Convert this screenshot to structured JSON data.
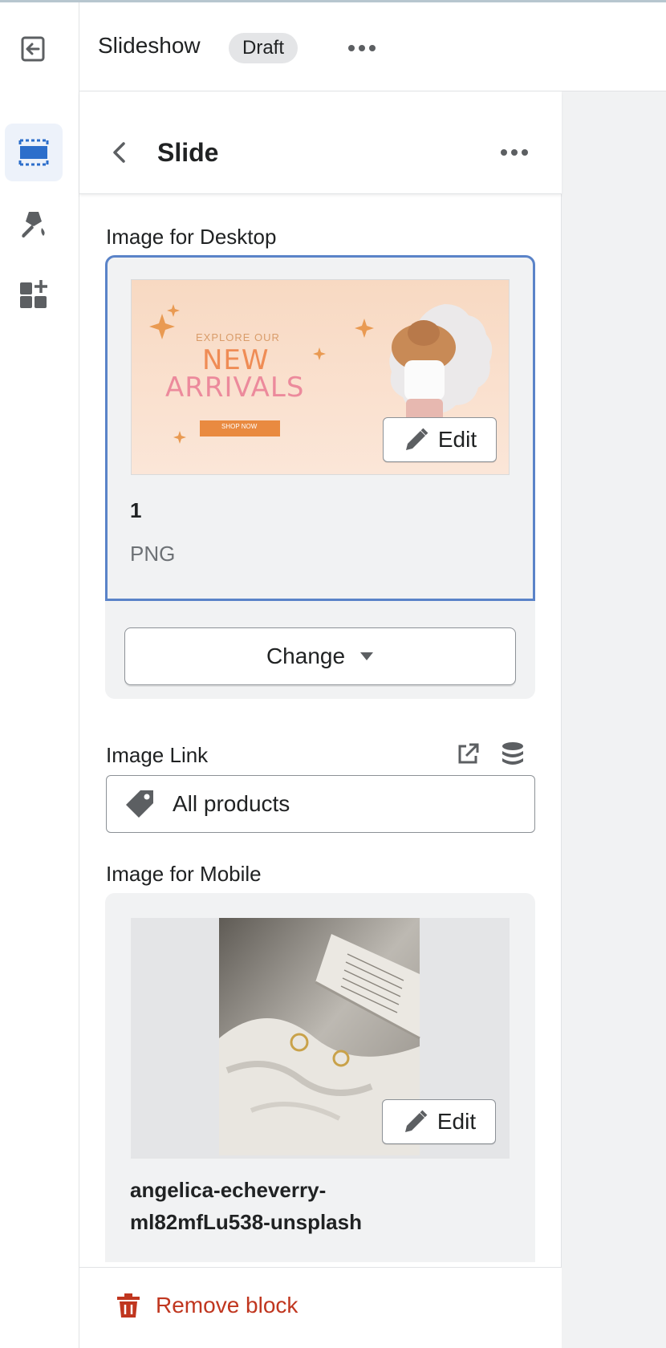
{
  "header": {
    "title": "Slideshow",
    "badge": "Draft"
  },
  "panel": {
    "title": "Slide",
    "desktop": {
      "label": "Image for Desktop",
      "thumb_text": {
        "explore": "EXPLORE OUR",
        "new": "NEW",
        "arrivals": "ARRIVALS",
        "shop": "SHOP NOW"
      },
      "edit_label": "Edit",
      "file_name": "1",
      "file_type": "PNG",
      "change_label": "Change"
    },
    "link": {
      "label": "Image Link",
      "value": "All products"
    },
    "mobile": {
      "label": "Image for Mobile",
      "edit_label": "Edit",
      "file_name_line1": "angelica-echeverry-",
      "file_name_line2": "ml82mfLu538-unsplash"
    },
    "remove_label": "Remove block"
  },
  "colors": {
    "accent": "#5a83c8",
    "danger": "#c0361f",
    "rail_active": "#edf2fa"
  }
}
